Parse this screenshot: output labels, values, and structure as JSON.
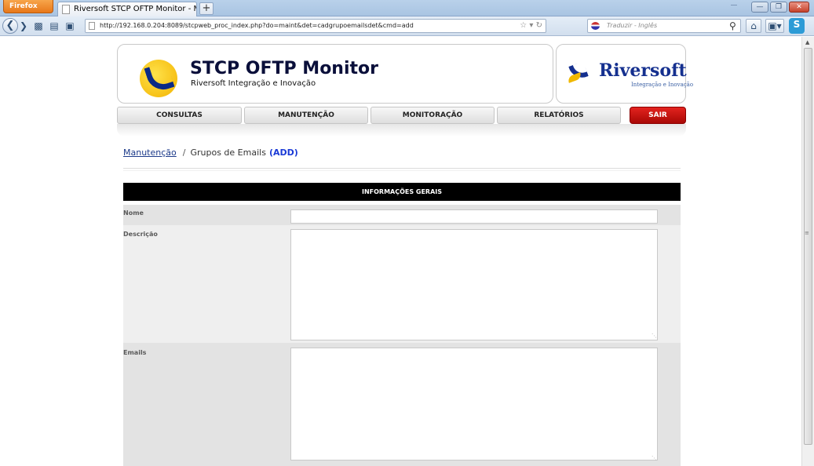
{
  "browser": {
    "app_button": "Firefox",
    "tab_title": "Riversoft STCP OFTP Monitor - Manuten...",
    "new_tab": "+",
    "url": "http://192.168.0.204:8089/stcpweb_proc_index.php?do=maint&det=cadgrupoemailsdet&cmd=add",
    "search_placeholder": "Traduzir - Inglês"
  },
  "header": {
    "app_title": "STCP OFTP Monitor",
    "app_subtitle": "Riversoft Integração e Inovação",
    "brand_name": "Riversoft",
    "brand_tagline": "Integração e Inovação"
  },
  "menu": {
    "consultas": "CONSULTAS",
    "manutencao": "MANUTENÇÃO",
    "monitoracao": "MONITORAÇÃO",
    "relatorios": "RELATÓRIOS",
    "sair": "SAIR"
  },
  "breadcrumb": {
    "parent": "Manutenção",
    "separator": "/",
    "current": "Grupos de Emails",
    "mode": "(ADD)"
  },
  "form": {
    "section_title": "INFORMAÇÕES GERAIS",
    "nome_label": "Nome",
    "nome_value": "",
    "descricao_label": "Descrição",
    "descricao_value": "",
    "emails_label": "Emails",
    "emails_value": ""
  },
  "colors": {
    "accent_blue": "#1c3a8a",
    "sair_red": "#c8100c",
    "form_header_bg": "#000000",
    "row_gray": "#e3e3e3"
  }
}
